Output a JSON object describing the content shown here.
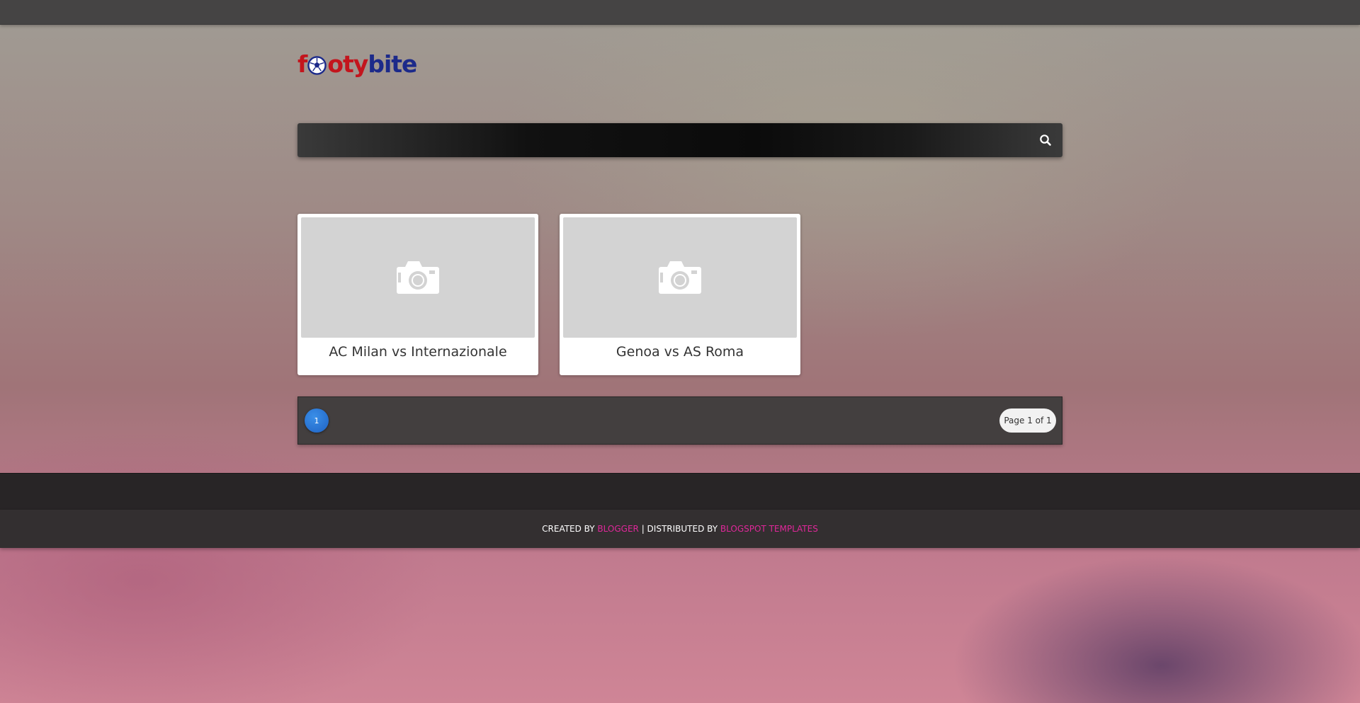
{
  "brand": {
    "logo_part1": "f",
    "logo_part2": "oty",
    "logo_part3": "bite",
    "colors": {
      "red": "#c3151d",
      "blue": "#1c2a8a"
    }
  },
  "search": {
    "placeholder": "",
    "value": "",
    "icon": "search-icon"
  },
  "posts": [
    {
      "title": "AC Milan vs Internazionale",
      "thumbnail_icon": "camera-icon"
    },
    {
      "title": "Genoa vs AS Roma",
      "thumbnail_icon": "camera-icon"
    }
  ],
  "pagination": {
    "current_page": "1",
    "info": "Page 1 of 1",
    "accent": "#2b7ad8"
  },
  "footer": {
    "created_by": "CREATED BY",
    "blogger_link": "BLOGGER",
    "separator": "| DISTRIBUTED BY",
    "templates_link": "BLOGSPOT TEMPLATES",
    "link_color": "#e0279a"
  }
}
